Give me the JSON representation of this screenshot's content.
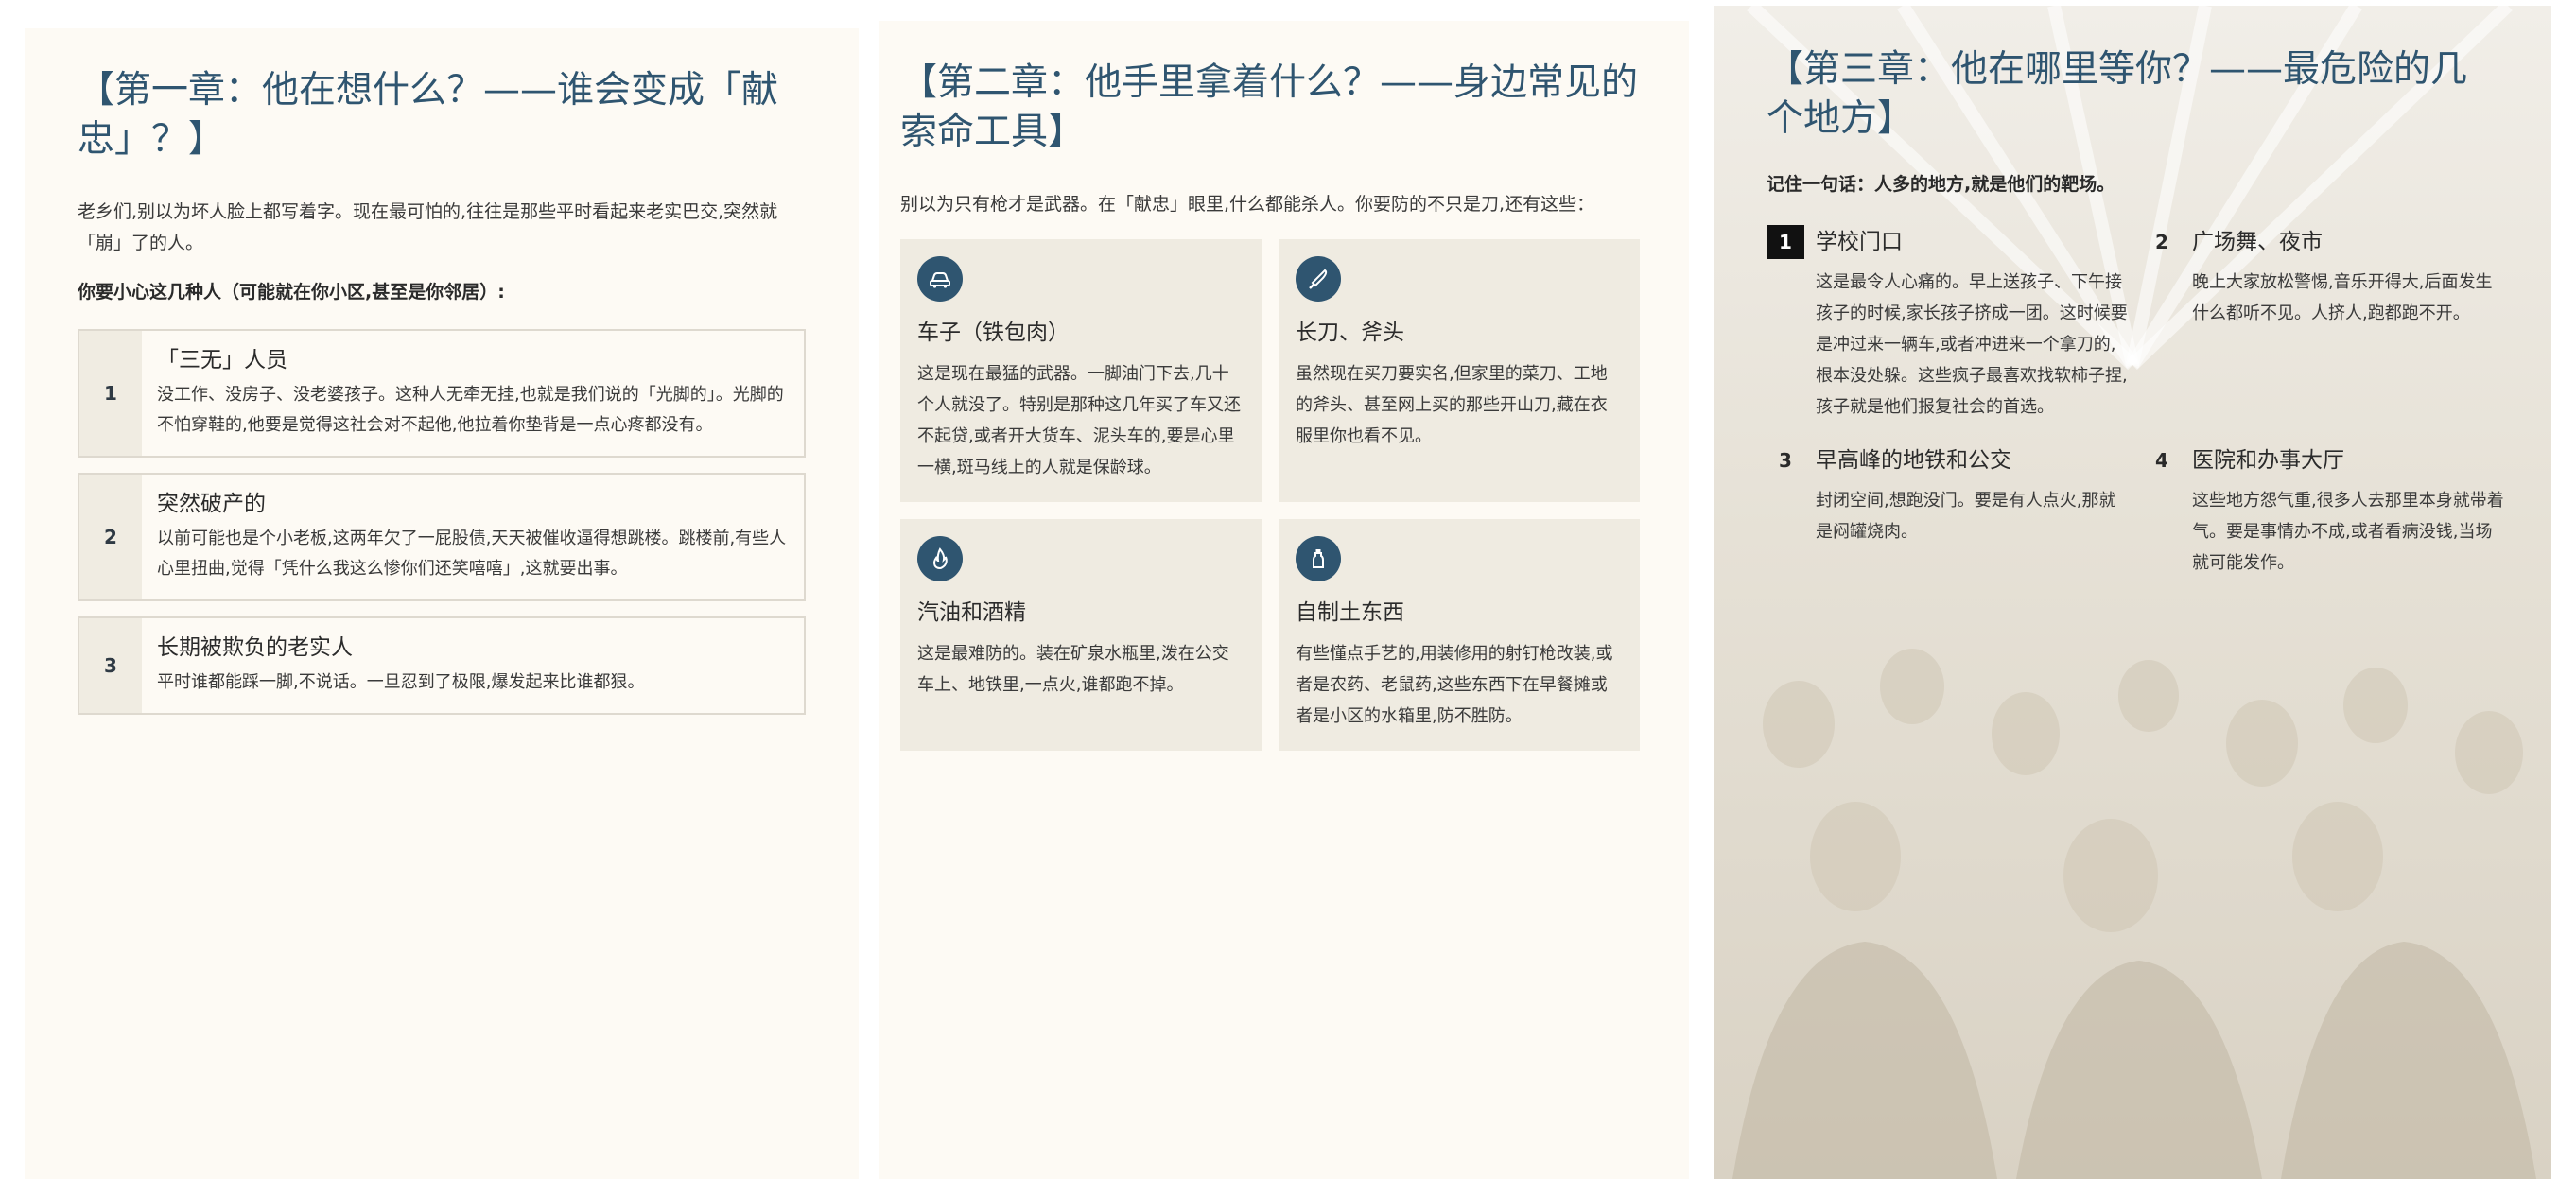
{
  "chapter1": {
    "title": "【第一章：他在想什么？——谁会变成「献忠」？】",
    "intro": "老乡们,别以为坏人脸上都写着字。现在最可怕的,往往是那些平时看起来老实巴交,突然就「崩」了的人。",
    "emphasis": "你要小心这几种人（可能就在你小区,甚至是你邻居）:",
    "items": [
      {
        "num": "1",
        "title": "「三无」人员",
        "text": "没工作、没房子、没老婆孩子。这种人无牵无挂,也就是我们说的「光脚的」。光脚的不怕穿鞋的,他要是觉得这社会对不起他,他拉着你垫背是一点心疼都没有。"
      },
      {
        "num": "2",
        "title": "突然破产的",
        "text": "以前可能也是个小老板,这两年欠了一屁股债,天天被催收逼得想跳楼。跳楼前,有些人心里扭曲,觉得「凭什么我这么惨你们还笑嘻嘻」,这就要出事。"
      },
      {
        "num": "3",
        "title": "长期被欺负的老实人",
        "text": "平时谁都能踩一脚,不说话。一旦忍到了极限,爆发起来比谁都狠。"
      }
    ]
  },
  "chapter2": {
    "title": "【第二章：他手里拿着什么？——身边常见的索命工具】",
    "intro": "别以为只有枪才是武器。在「献忠」眼里,什么都能杀人。你要防的不只是刀,还有这些：",
    "tools": [
      {
        "icon": "car-icon",
        "title": "车子（铁包肉）",
        "text": "这是现在最猛的武器。一脚油门下去,几十个人就没了。特别是那种这几年买了车又还不起贷,或者开大货车、泥头车的,要是心里一横,斑马线上的人就是保龄球。"
      },
      {
        "icon": "knife-icon",
        "title": "长刀、斧头",
        "text": "虽然现在买刀要实名,但家里的菜刀、工地的斧头、甚至网上买的那些开山刀,藏在衣服里你也看不见。"
      },
      {
        "icon": "fire-icon",
        "title": "汽油和酒精",
        "text": "这是最难防的。装在矿泉水瓶里,泼在公交车上、地铁里,一点火,谁都跑不掉。"
      },
      {
        "icon": "bottle-icon",
        "title": "自制土东西",
        "text": "有些懂点手艺的,用装修用的射钉枪改装,或者是农药、老鼠药,这些东西下在早餐摊或者是小区的水箱里,防不胜防。"
      }
    ]
  },
  "chapter3": {
    "title": "【第三章：他在哪里等你？——最危险的几个地方】",
    "emphasis": "记住一句话：人多的地方,就是他们的靶场。",
    "places": [
      {
        "num": "1",
        "title": "学校门口",
        "text": "这是最令人心痛的。早上送孩子、下午接孩子的时候,家长孩子挤成一团。这时候要是冲过来一辆车,或者冲进来一个拿刀的,根本没处躲。这些疯子最喜欢找软柿子捏,孩子就是他们报复社会的首选。"
      },
      {
        "num": "2",
        "title": "广场舞、夜市",
        "text": "晚上大家放松警惕,音乐开得大,后面发生什么都听不见。人挤人,跑都跑不开。"
      },
      {
        "num": "3",
        "title": "早高峰的地铁和公交",
        "text": "封闭空间,想跑没门。要是有人点火,那就是闷罐烧肉。"
      },
      {
        "num": "4",
        "title": "医院和办事大厅",
        "text": "这些地方怨气重,很多人去那里本身就带着气。要是事情办不成,或者看病没钱,当场就可能发作。"
      }
    ]
  },
  "colors": {
    "accent": "#2f5570",
    "card": "#efebe1",
    "page": "#fdfaf4"
  }
}
